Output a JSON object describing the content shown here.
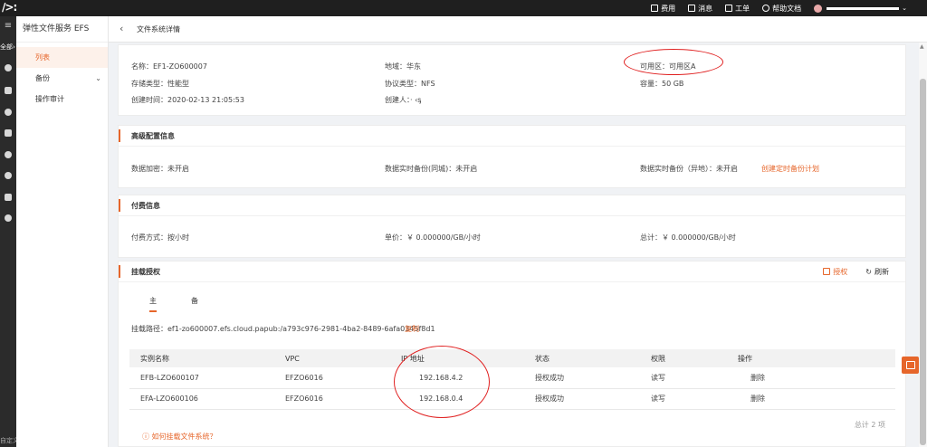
{
  "topbar": {
    "logo": "/>:",
    "nav": [
      {
        "label": "费用",
        "icon": "bill-icon"
      },
      {
        "label": "消息",
        "icon": "message-icon"
      },
      {
        "label": "工单",
        "icon": "ticket-icon"
      },
      {
        "label": "帮助文档",
        "icon": "help-icon"
      }
    ]
  },
  "rail": {
    "all_label": "全部",
    "custom_label": "自定义"
  },
  "sidebar": {
    "title": "弹性文件服务 EFS",
    "items": [
      {
        "label": "列表",
        "active": true
      },
      {
        "label": "备份"
      },
      {
        "label": "操作审计"
      }
    ]
  },
  "header": {
    "title": "文件系统详情"
  },
  "basic": {
    "name": "名称：EF1-ZO600007",
    "region": "地域：华东",
    "zone": "可用区：可用区A",
    "storage_type": "存储类型：性能型",
    "protocol": "协议类型：NFS",
    "capacity": "容量：50 GB",
    "created_time": "创建时间：2020-02-13 21:05:53",
    "creator": "创建人：‧ ‹ᶊ"
  },
  "advanced": {
    "title": "高级配置信息",
    "encryption": "数据加密：未开启",
    "realtime_backup_same_city": "数据实时备份(同城)：未开启",
    "realtime_backup_remote": "数据实时备份（异地）：未开启",
    "create_backup_link": "创建定时备份计划"
  },
  "payment": {
    "title": "付费信息",
    "method": "付费方式：按小时",
    "unit_price": "单价：￥ 0.000000/GB/小时",
    "total": "总计：￥ 0.000000/GB/小时"
  },
  "mount": {
    "title": "挂载授权",
    "authorize_label": "授权",
    "refresh_label": "刷新",
    "tabs": [
      "主",
      "备"
    ],
    "path_label": "挂载路径：",
    "path_value": "ef1-zo600007.efs.cloud.papub:/a793c976-2981-4ba2-8489-6afa0345f8d1",
    "copy_label": "复制",
    "columns": [
      "实例名称",
      "VPC",
      "IP 地址",
      "状态",
      "权限",
      "操作"
    ],
    "rows": [
      {
        "instance": "EFB-LZO600107",
        "vpc": "EFZO6016",
        "ip": "192.168.4.2",
        "status": "授权成功",
        "perm": "读写",
        "op": "删除"
      },
      {
        "instance": "EFA-LZO600106",
        "vpc": "EFZO6016",
        "ip": "192.168.0.4",
        "status": "授权成功",
        "perm": "读写",
        "op": "删除"
      }
    ],
    "total_label": "总计 2 项",
    "help_link": "如何挂载文件系统？"
  },
  "colors": {
    "accent": "#e6662b",
    "annotation": "#e02020"
  }
}
